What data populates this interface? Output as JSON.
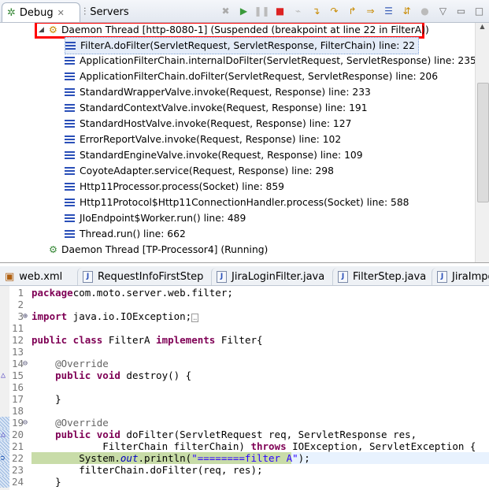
{
  "debug_view": {
    "tabs": [
      {
        "label": "Debug",
        "icon": "debug-bug-icon",
        "active": true
      },
      {
        "label": "Servers",
        "icon": "servers-icon",
        "active": false
      }
    ],
    "toolbar": [
      "remove-terminated-icon",
      "resume-icon",
      "suspend-icon",
      "terminate-icon",
      "disconnect-icon",
      "step-into-icon",
      "step-over-icon",
      "step-return-icon",
      "drop-to-frame-icon",
      "use-step-filters-icon",
      "instruction-stepping-icon",
      "threads-icon",
      "view-menu-icon",
      "minimize-icon",
      "maximize-icon"
    ],
    "threads": [
      {
        "label": "Daemon Thread [http-8080-1] (Suspended (breakpoint at line 22 in FilterA))",
        "highlight_color": "#ff0000",
        "frames": [
          "FilterA.doFilter(ServletRequest, ServletResponse, FilterChain) line: 22",
          "ApplicationFilterChain.internalDoFilter(ServletRequest, ServletResponse) line: 235",
          "ApplicationFilterChain.doFilter(ServletRequest, ServletResponse) line: 206",
          "StandardWrapperValve.invoke(Request, Response) line: 233",
          "StandardContextValve.invoke(Request, Response) line: 191",
          "StandardHostValve.invoke(Request, Response) line: 127",
          "ErrorReportValve.invoke(Request, Response) line: 102",
          "StandardEngineValve.invoke(Request, Response) line: 109",
          "CoyoteAdapter.service(Request, Response) line: 298",
          "Http11Processor.process(Socket) line: 859",
          "Http11Protocol$Http11ConnectionHandler.process(Socket) line: 588",
          "JIoEndpoint$Worker.run() line: 489",
          "Thread.run() line: 662"
        ]
      },
      {
        "label": "Daemon Thread [TP-Processor4] (Running)"
      }
    ]
  },
  "editor": {
    "tabs": [
      "web.xml",
      "RequestInfoFirstStep",
      "JiraLoginFilter.java",
      "FilterStep.java",
      "JiraImpo"
    ],
    "current_line": 22,
    "lines": [
      {
        "n": "1",
        "segs": [
          [
            "kw",
            "package"
          ],
          [
            "",
            "com.moto.server.web.filter;"
          ]
        ]
      },
      {
        "n": "2",
        "segs": []
      },
      {
        "n": "3",
        "fold": "+",
        "segs": [
          [
            "kw",
            "import"
          ],
          [
            "",
            " java.io.IOException;"
          ],
          [
            "box",
            "…"
          ]
        ]
      },
      {
        "n": "11",
        "segs": []
      },
      {
        "n": "12",
        "segs": [
          [
            "kw",
            "public class"
          ],
          [
            "",
            " FilterA "
          ],
          [
            "kw",
            "implements"
          ],
          [
            "",
            " Filter{"
          ]
        ]
      },
      {
        "n": "13",
        "segs": []
      },
      {
        "n": "14",
        "fold": "-",
        "segs": [
          [
            "ann",
            "    @Override"
          ]
        ]
      },
      {
        "n": "15",
        "marker": "override",
        "segs": [
          [
            "kw",
            "    public void"
          ],
          [
            "",
            " destroy() {"
          ]
        ]
      },
      {
        "n": "16",
        "segs": []
      },
      {
        "n": "17",
        "segs": [
          [
            "",
            "    }"
          ]
        ]
      },
      {
        "n": "18",
        "segs": []
      },
      {
        "n": "19",
        "fold": "-",
        "segs": [
          [
            "ann",
            "    @Override"
          ]
        ]
      },
      {
        "n": "20",
        "marker": "override",
        "segs": [
          [
            "kw",
            "    public void"
          ],
          [
            "",
            " doFilter(ServletRequest req, ServletResponse res,"
          ]
        ]
      },
      {
        "n": "21",
        "segs": [
          [
            "",
            "            FilterChain filterChain) "
          ],
          [
            "kw",
            "throws"
          ],
          [
            "",
            " IOException, ServletException {"
          ]
        ]
      },
      {
        "n": "22",
        "marker": "current",
        "segs": [
          [
            "",
            "        System."
          ],
          [
            "ital",
            "out"
          ],
          [
            "",
            ".println("
          ],
          [
            "str",
            "\"========filter A\""
          ],
          [
            "",
            ");"
          ]
        ]
      },
      {
        "n": "23",
        "segs": [
          [
            "",
            "        filterChain.doFilter(req, res);"
          ]
        ]
      },
      {
        "n": "24",
        "segs": [
          [
            "",
            "    }"
          ]
        ]
      }
    ]
  }
}
